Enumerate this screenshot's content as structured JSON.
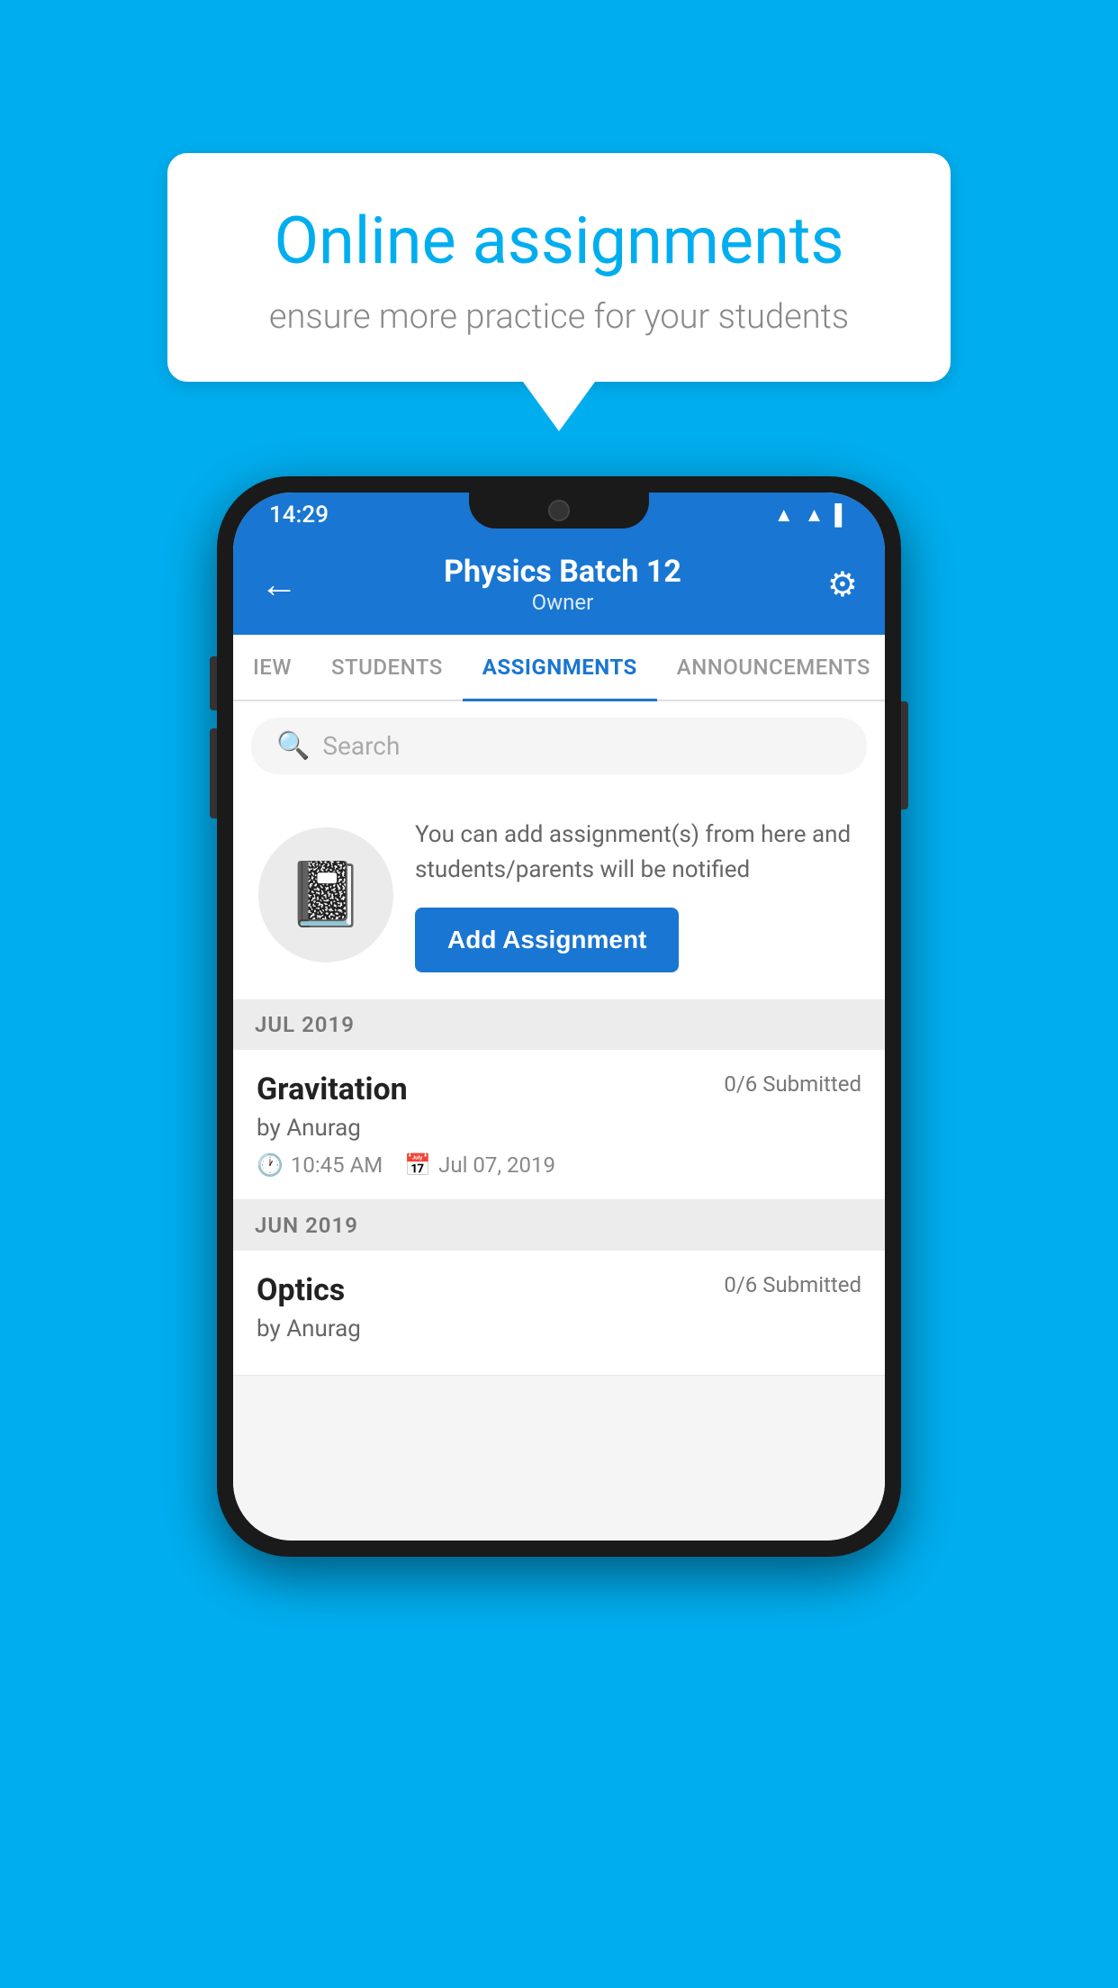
{
  "background_color": "#00AEEF",
  "speech_bubble": {
    "title": "Online assignments",
    "subtitle": "ensure more practice for your students"
  },
  "phone": {
    "status_bar": {
      "time": "14:29",
      "icons": [
        "▲▲",
        "◀▶",
        "▌▌"
      ]
    },
    "header": {
      "title": "Physics Batch 12",
      "subtitle": "Owner",
      "back_label": "←",
      "settings_label": "⚙"
    },
    "tabs": [
      {
        "label": "IEW",
        "active": false
      },
      {
        "label": "STUDENTS",
        "active": false
      },
      {
        "label": "ASSIGNMENTS",
        "active": true
      },
      {
        "label": "ANNOUNCEMENTS",
        "active": false
      }
    ],
    "search": {
      "placeholder": "Search"
    },
    "promo": {
      "description": "You can add assignment(s) from here and students/parents will be notified",
      "button_label": "Add Assignment"
    },
    "sections": [
      {
        "month_label": "JUL 2019",
        "assignments": [
          {
            "name": "Gravitation",
            "submitted": "0/6 Submitted",
            "author": "by Anurag",
            "time": "10:45 AM",
            "date": "Jul 07, 2019"
          }
        ]
      },
      {
        "month_label": "JUN 2019",
        "assignments": [
          {
            "name": "Optics",
            "submitted": "0/6 Submitted",
            "author": "by Anurag",
            "time": "",
            "date": ""
          }
        ]
      }
    ]
  }
}
